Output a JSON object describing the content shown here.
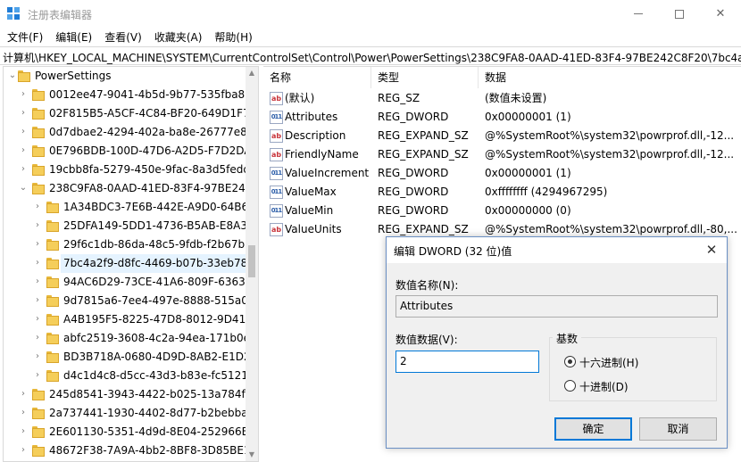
{
  "window": {
    "title": "注册表编辑器",
    "accent_color": "#0078d7"
  },
  "menu": [
    "文件(F)",
    "编辑(E)",
    "查看(V)",
    "收藏夹(A)",
    "帮助(H)"
  ],
  "address": "计算机\\HKEY_LOCAL_MACHINE\\SYSTEM\\CurrentControlSet\\Control\\Power\\PowerSettings\\238C9FA8-0AAD-41ED-83F4-97BE242C8F20\\7bc4a2f9-d8fc-4469-b07b-33eb785",
  "tree": {
    "root": "PowerSettings",
    "items": [
      {
        "label": "0012ee47-9041-4b5d-9b77-535fba8b"
      },
      {
        "label": "02F815B5-A5CF-4C84-BF20-649D1F75"
      },
      {
        "label": "0d7dbae2-4294-402a-ba8e-26777e84"
      },
      {
        "label": "0E796BDB-100D-47D6-A2D5-F7D2DAA"
      },
      {
        "label": "19cbb8fa-5279-450e-9fac-8a3d5fedd0"
      },
      {
        "label": "238C9FA8-0AAD-41ED-83F4-97BE242C"
      },
      {
        "label": "1A34BDC3-7E6B-442E-A9D0-64B6EF"
      },
      {
        "label": "25DFA149-5DD1-4736-B5AB-E8A37"
      },
      {
        "label": "29f6c1db-86da-48c5-9fdb-f2b67b1"
      },
      {
        "label": "7bc4a2f9-d8fc-4469-b07b-33eb785"
      },
      {
        "label": "94AC6D29-73CE-41A6-809F-6363BA"
      },
      {
        "label": "9d7815a6-7ee4-497e-8888-515a05"
      },
      {
        "label": "A4B195F5-8225-47D8-8012-9D4136"
      },
      {
        "label": "abfc2519-3608-4c2a-94ea-171b0ec"
      },
      {
        "label": "BD3B718A-0680-4D9D-8AB2-E1D2I"
      },
      {
        "label": "d4c1d4c8-d5cc-43d3-b83e-fc51215"
      },
      {
        "label": "245d8541-3943-4422-b025-13a784f6"
      },
      {
        "label": "2a737441-1930-4402-8d77-b2bebba3"
      },
      {
        "label": "2E601130-5351-4d9d-8E04-252966BA"
      },
      {
        "label": "48672F38-7A9A-4bb2-8BF8-3D85BE19"
      }
    ]
  },
  "values": {
    "columns": [
      "名称",
      "类型",
      "数据"
    ],
    "rows": [
      {
        "name": "(默认)",
        "type": "REG_SZ",
        "data": "(数值未设置)",
        "icon": "string-value-icon"
      },
      {
        "name": "Attributes",
        "type": "REG_DWORD",
        "data": "0x00000001 (1)",
        "icon": "binary-value-icon"
      },
      {
        "name": "Description",
        "type": "REG_EXPAND_SZ",
        "data": "@%SystemRoot%\\system32\\powrprof.dll,-12...",
        "icon": "string-value-icon"
      },
      {
        "name": "FriendlyName",
        "type": "REG_EXPAND_SZ",
        "data": "@%SystemRoot%\\system32\\powrprof.dll,-12...",
        "icon": "string-value-icon"
      },
      {
        "name": "ValueIncrement",
        "type": "REG_DWORD",
        "data": "0x00000001 (1)",
        "icon": "binary-value-icon"
      },
      {
        "name": "ValueMax",
        "type": "REG_DWORD",
        "data": "0xffffffff (4294967295)",
        "icon": "binary-value-icon"
      },
      {
        "name": "ValueMin",
        "type": "REG_DWORD",
        "data": "0x00000000 (0)",
        "icon": "binary-value-icon"
      },
      {
        "name": "ValueUnits",
        "type": "REG_EXPAND_SZ",
        "data": "@%SystemRoot%\\system32\\powrprof.dll,-80,...",
        "icon": "string-value-icon"
      }
    ]
  },
  "dialog": {
    "title": "编辑 DWORD (32 位)值",
    "value_name_label": "数值名称(N):",
    "value_name": "Attributes",
    "value_data_label": "数值数据(V):",
    "value_data": "2",
    "base_label": "基数",
    "hex_label": "十六进制(H)",
    "dec_label": "十进制(D)",
    "ok_label": "确定",
    "cancel_label": "取消"
  }
}
